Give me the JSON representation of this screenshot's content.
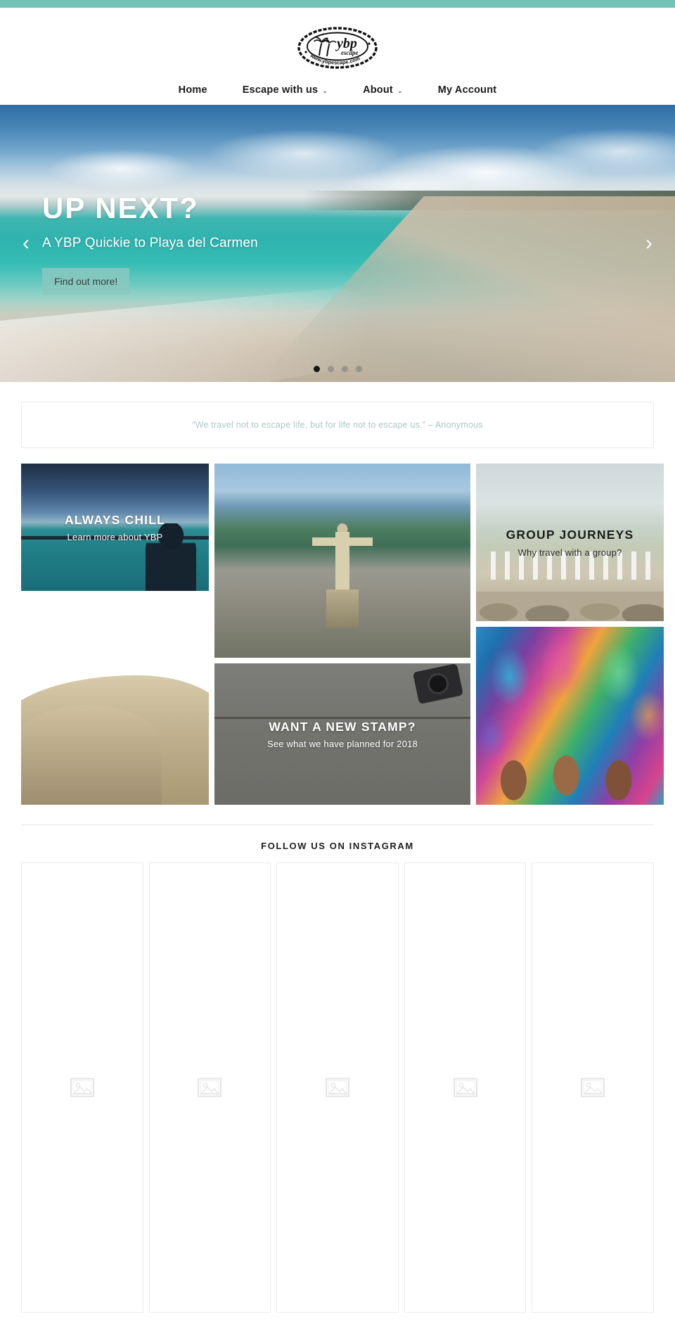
{
  "topbar": {
    "color": "#72c2b5"
  },
  "header": {
    "logo": {
      "brand": "ybp",
      "sub": "escape",
      "url_text": "www.ybpescape.com",
      "alt": "ybp escape stamp logo"
    }
  },
  "nav": {
    "items": [
      {
        "label": "Home",
        "has_caret": false
      },
      {
        "label": "Escape with us",
        "has_caret": true
      },
      {
        "label": "About",
        "has_caret": true
      },
      {
        "label": "My Account",
        "has_caret": false
      }
    ],
    "caret_glyph": "⌄"
  },
  "hero": {
    "title": "UP NEXT?",
    "subtitle": "A YBP Quickie to Playa del Carmen",
    "button_label": "Find out more!",
    "button_color": "#89c8be",
    "prev_glyph": "‹",
    "next_glyph": "›",
    "dots": 4,
    "active_dot": 1
  },
  "quote": {
    "text": "“We travel not to escape life, but for life not to escape us.” – Anonymous",
    "color": "#aec6c4"
  },
  "mosaic": {
    "tiles": [
      {
        "id": "always-chill",
        "title": "ALWAYS CHILL",
        "subtitle": "Learn more about YBP",
        "text_tone": "light"
      },
      {
        "id": "rio",
        "title": "",
        "subtitle": "",
        "text_tone": "light"
      },
      {
        "id": "group-journeys",
        "title": "GROUP JOURNEYS",
        "subtitle": "Why travel with a group?",
        "text_tone": "dark"
      },
      {
        "id": "gaudi",
        "title": "",
        "subtitle": "",
        "text_tone": "light"
      },
      {
        "id": "new-stamp",
        "title": "WANT A NEW STAMP?",
        "subtitle": "See what we have planned for 2018",
        "text_tone": "light"
      },
      {
        "id": "carnival",
        "title": "",
        "subtitle": "",
        "text_tone": "light"
      }
    ]
  },
  "instagram": {
    "heading": "FOLLOW US ON INSTAGRAM",
    "cells": [
      {
        "placeholder_icon": "broken-image-icon"
      },
      {
        "placeholder_icon": "broken-image-icon"
      },
      {
        "placeholder_icon": "broken-image-icon"
      },
      {
        "placeholder_icon": "broken-image-icon"
      },
      {
        "placeholder_icon": "broken-image-icon"
      }
    ]
  }
}
